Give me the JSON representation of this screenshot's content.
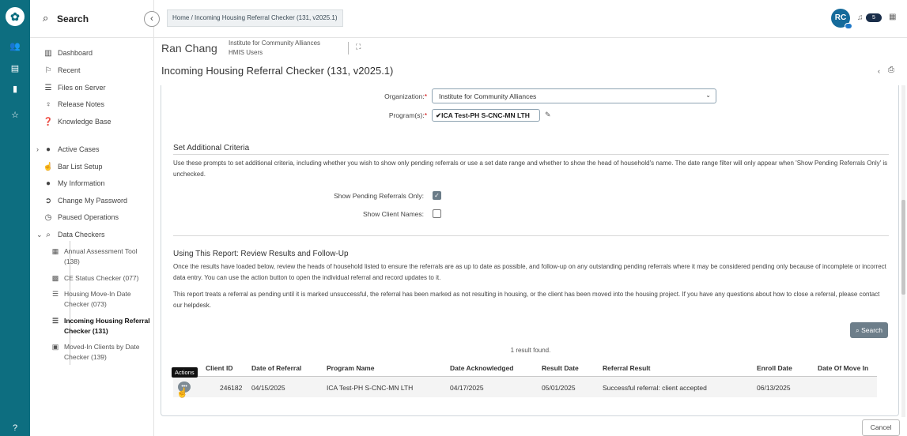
{
  "rail": {
    "logo": "ℹ",
    "icons": [
      "users-icon",
      "id-card-icon",
      "document-icon",
      "star-icon",
      "help-icon"
    ]
  },
  "sidebar": {
    "search_label": "Search",
    "items": [
      {
        "label": "Dashboard",
        "icon": "map-icon"
      },
      {
        "label": "Recent",
        "icon": "flag-icon"
      },
      {
        "label": "Files on Server",
        "icon": "list-icon"
      },
      {
        "label": "Release Notes",
        "icon": "bulb-icon"
      },
      {
        "label": "Knowledge Base",
        "icon": "question-circle-icon"
      },
      {
        "label": "Active Cases",
        "icon": "user-icon"
      },
      {
        "label": "Bar List Setup",
        "icon": "hand-icon"
      },
      {
        "label": "My Information",
        "icon": "user-icon"
      },
      {
        "label": "Change My Password",
        "icon": "arrow-circle-icon"
      },
      {
        "label": "Paused Operations",
        "icon": "clock-icon"
      },
      {
        "label": "Data Checkers",
        "icon": "search-icon"
      }
    ],
    "sub_items": [
      {
        "label1": "Annual Assessment Tool",
        "label2": "(138)"
      },
      {
        "label1": "CE Status Checker (077)",
        "label2": ""
      },
      {
        "label1": "Housing Move-In Date",
        "label2": "Checker (073)"
      },
      {
        "label1": "Incoming Housing Referral",
        "label2": "Checker (131)"
      },
      {
        "label1": "Moved-In Clients by Date",
        "label2": "Checker (139)"
      }
    ]
  },
  "topbar": {
    "breadcrumb": "Home  /  Incoming Housing Referral Checker (131, v2025.1)",
    "avatar_initials": "RC",
    "notification_count": "5"
  },
  "userbar": {
    "user_name": "Ran Chang",
    "org_line1": "Institute for Community Alliances",
    "org_line2": "HMIS Users",
    "page_title": "Incoming Housing Referral Checker (131, v2025.1)"
  },
  "form": {
    "organization_label": "Organization:",
    "organization_value": "Institute for Community Alliances",
    "programs_label": "Program(s):",
    "program_value": "ICA Test-PH S-CNC-MN LTH",
    "required_mark": "*"
  },
  "criteria": {
    "title": "Set Additional Criteria",
    "description": "Use these prompts to set additional criteria, including whether you wish to show only pending referrals or use a set date range and whether to show the head of household's name. The date range filter will only appear when 'Show Pending Referrals Only' is unchecked.",
    "pending_label": "Show Pending Referrals Only:",
    "pending_checked": true,
    "names_label": "Show Client Names:",
    "names_checked": false
  },
  "report": {
    "title": "Using This Report: Review Results and Follow-Up",
    "para1": "Once the results have loaded below, review the heads of household listed to ensure the referrals are as up to date as possible, and follow-up on any outstanding pending referrals where it may be considered pending only because of incomplete or incorrect data entry. You can use the action button to open the individual referral and record updates to it.",
    "para2": "This report treats a referral as pending until it is marked unsuccessful, the referral has been marked as not resulting in housing, or the client has been moved into the housing project. If you have any questions about how to close a referral, please contact our helpdesk.",
    "search_button": "Search",
    "result_count": "1 result found."
  },
  "table": {
    "actions_tooltip": "Actions",
    "headers": [
      "Client ID",
      "Date of Referral",
      "Program Name",
      "Date Acknowledged",
      "Result Date",
      "Referral Result",
      "Enroll Date",
      "Date Of Move In"
    ],
    "row": [
      "246182",
      "04/15/2025",
      "ICA Test-PH S-CNC-MN LTH",
      "04/17/2025",
      "05/01/2025",
      "Successful referral: client accepted",
      "06/13/2025",
      ""
    ]
  },
  "footer": {
    "cancel_button": "Cancel"
  }
}
